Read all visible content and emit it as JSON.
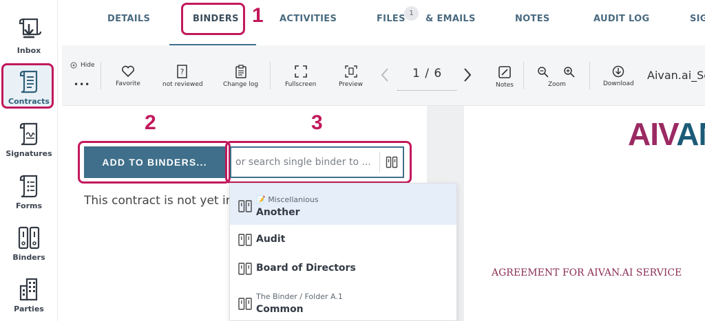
{
  "sidebar": {
    "items": [
      {
        "label": "Inbox",
        "icon": "inbox-icon"
      },
      {
        "label": "Contracts",
        "icon": "contracts-icon",
        "active": true
      },
      {
        "label": "Signatures",
        "icon": "signatures-icon"
      },
      {
        "label": "Forms",
        "icon": "forms-icon"
      },
      {
        "label": "Binders",
        "icon": "binders-icon"
      },
      {
        "label": "Parties",
        "icon": "parties-icon"
      }
    ]
  },
  "tabs": {
    "items": [
      "DETAILS",
      "BINDERS",
      "ACTIVITIES",
      "FILES",
      "& EMAILS",
      "NOTES",
      "AUDIT LOG",
      "SIG"
    ],
    "active": "BINDERS",
    "files_badge": "1"
  },
  "annotations": {
    "step1": "1",
    "step2": "2",
    "step3": "3"
  },
  "toolbar": {
    "hide_label": "Hide",
    "more_label": "•••",
    "favorite_label": "Favorite",
    "not_reviewed_label": "not reviewed",
    "change_log_label": "Change log",
    "fullscreen_label": "Fullscreen",
    "preview_label": "Preview",
    "page_indicator": "1 / 6",
    "notes_label": "Notes",
    "zoom_label": "Zoom",
    "download_label": "Download",
    "file_name": "Aivan.ai_Se"
  },
  "binders_panel": {
    "add_button_label": "ADD TO BINDERS...",
    "search_placeholder": "or search single binder to ...",
    "empty_message": "This contract is not yet in"
  },
  "dropdown": {
    "items": [
      {
        "parent": "📝 Miscellanious",
        "name": "Another",
        "highlighted": true
      },
      {
        "parent": "",
        "name": "Audit"
      },
      {
        "parent": "",
        "name": "Board of Directors"
      },
      {
        "parent": "The Binder / Folder A.1",
        "name": "Common"
      }
    ]
  },
  "document": {
    "logo_text": "AIVAN",
    "title": "AGREEMENT FOR AIVAN.AI SERVICE"
  },
  "colors": {
    "accent": "#3f6f8a",
    "highlight": "#c2185b",
    "logo_purple": "#9b2a63",
    "logo_teal": "#1c5b78"
  }
}
